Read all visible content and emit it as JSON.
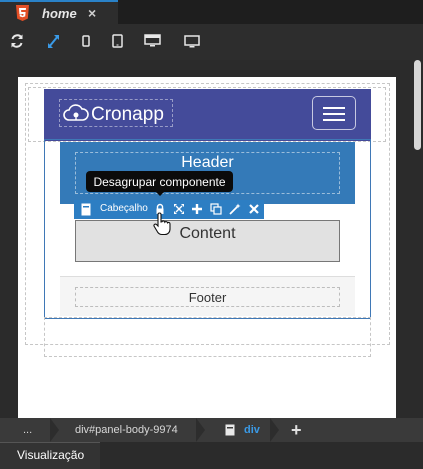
{
  "editor": {
    "tab": {
      "title": "home",
      "close_symbol": "×"
    },
    "toolbar": {
      "refresh_icon": "refresh-icon",
      "fit_icon": "expand-icon",
      "device_icons": [
        "phone-icon",
        "tablet-icon",
        "desktop-icon",
        "monitor-icon"
      ]
    }
  },
  "preview": {
    "navbar": {
      "logo_text": "Cronapp",
      "brand_color": "#444b9a"
    },
    "header": {
      "title": "Header",
      "color": "#347ab8"
    },
    "content": {
      "title": "Content"
    },
    "footer": {
      "title": "Footer"
    }
  },
  "component_toolbar": {
    "label": "Cabeçalho",
    "tooltip": "Desagrupar componente",
    "accent": "#2d7ec3",
    "actions": [
      "lock-icon",
      "move-icon",
      "add-icon",
      "copy-icon",
      "magic-wand-icon",
      "delete-icon"
    ]
  },
  "breadcrumb": {
    "items": [
      "...",
      "div#panel-body-9974",
      "div"
    ],
    "add_symbol": "+"
  },
  "status": {
    "label": "Visualização"
  }
}
